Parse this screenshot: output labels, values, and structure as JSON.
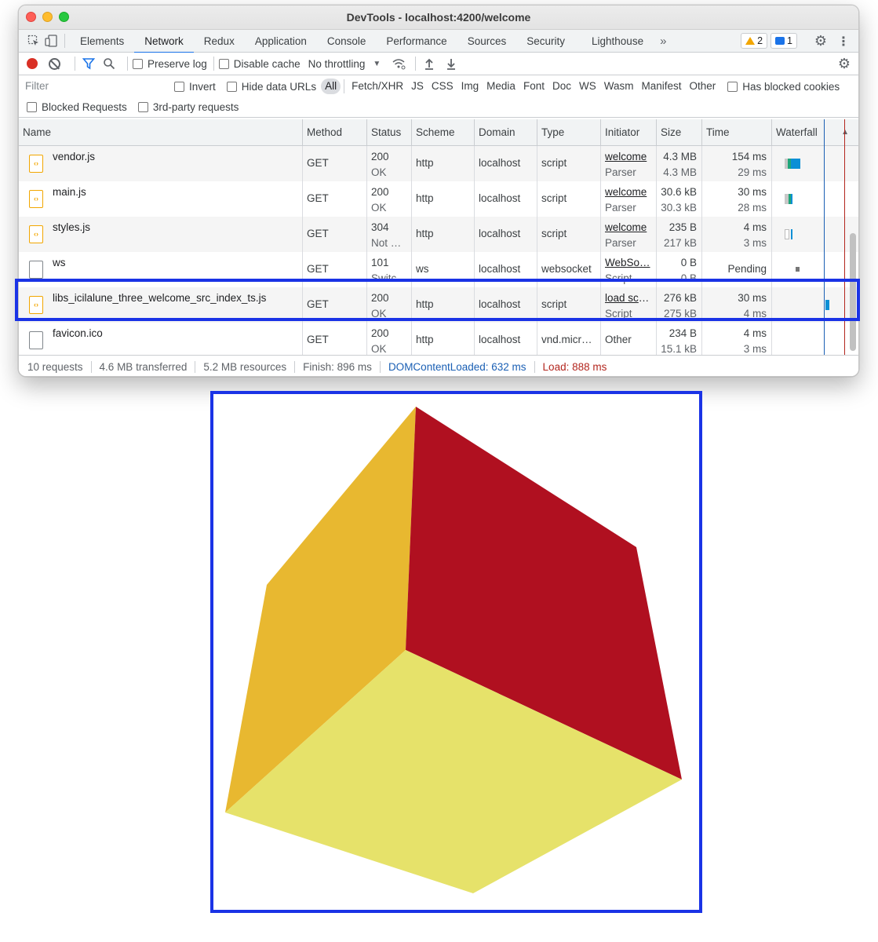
{
  "window": {
    "title": "DevTools - localhost:4200/welcome"
  },
  "tabs": [
    {
      "label": "Elements"
    },
    {
      "label": "Network"
    },
    {
      "label": "Redux"
    },
    {
      "label": "Application"
    },
    {
      "label": "Console"
    },
    {
      "label": "Performance"
    },
    {
      "label": "Sources"
    },
    {
      "label": "Security"
    },
    {
      "label": "Lighthouse"
    }
  ],
  "badges": {
    "warnings": "2",
    "messages": "1"
  },
  "toolbar": {
    "preserve_log": "Preserve log",
    "disable_cache": "Disable cache",
    "throttling": "No throttling"
  },
  "filter": {
    "placeholder": "Filter",
    "invert": "Invert",
    "hide_data_urls": "Hide data URLs",
    "types": [
      "All",
      "Fetch/XHR",
      "JS",
      "CSS",
      "Img",
      "Media",
      "Font",
      "Doc",
      "WS",
      "Wasm",
      "Manifest",
      "Other"
    ],
    "has_blocked_cookies": "Has blocked cookies",
    "blocked_requests": "Blocked Requests",
    "third_party": "3rd-party requests"
  },
  "columns": [
    "Name",
    "Method",
    "Status",
    "Scheme",
    "Domain",
    "Type",
    "Initiator",
    "Size",
    "Time",
    "Waterfall"
  ],
  "rows": [
    {
      "name": "vendor.js",
      "method": "GET",
      "status": "200",
      "status_text": "OK",
      "scheme": "http",
      "domain": "localhost",
      "type": "script",
      "initiator": "welcome",
      "initiator_sub": "Parser",
      "size": "4.3 MB",
      "size_sub": "4.3 MB",
      "time": "154 ms",
      "time_sub": "29 ms",
      "icon": "script-file-icon"
    },
    {
      "name": "main.js",
      "method": "GET",
      "status": "200",
      "status_text": "OK",
      "scheme": "http",
      "domain": "localhost",
      "type": "script",
      "initiator": "welcome",
      "initiator_sub": "Parser",
      "size": "30.6 kB",
      "size_sub": "30.3 kB",
      "time": "30 ms",
      "time_sub": "28 ms",
      "icon": "script-file-icon"
    },
    {
      "name": "styles.js",
      "method": "GET",
      "status": "304",
      "status_text": "Not …",
      "scheme": "http",
      "domain": "localhost",
      "type": "script",
      "initiator": "welcome",
      "initiator_sub": "Parser",
      "size": "235 B",
      "size_sub": "217 kB",
      "time": "4 ms",
      "time_sub": "3 ms",
      "icon": "script-file-icon"
    },
    {
      "name": "ws",
      "method": "GET",
      "status": "101",
      "status_text": "Switc…",
      "scheme": "ws",
      "domain": "localhost",
      "type": "websocket",
      "initiator": "WebSo…",
      "initiator_sub": "Script",
      "size": "0 B",
      "size_sub": "0 B",
      "time": "Pending",
      "time_sub": "",
      "icon": "document-icon"
    },
    {
      "name": "libs_icilalune_three_welcome_src_index_ts.js",
      "method": "GET",
      "status": "200",
      "status_text": "OK",
      "scheme": "http",
      "domain": "localhost",
      "type": "script",
      "initiator": "load scr…",
      "initiator_sub": "Script",
      "size": "276 kB",
      "size_sub": "275 kB",
      "time": "30 ms",
      "time_sub": "4 ms",
      "icon": "script-file-icon"
    },
    {
      "name": "favicon.ico",
      "method": "GET",
      "status": "200",
      "status_text": "OK",
      "scheme": "http",
      "domain": "localhost",
      "type": "vnd.micr…",
      "initiator": "Other",
      "initiator_sub": "",
      "size": "234 B",
      "size_sub": "15.1 kB",
      "time": "4 ms",
      "time_sub": "3 ms",
      "icon": "document-icon"
    }
  ],
  "status": {
    "requests": "10 requests",
    "transferred": "4.6 MB transferred",
    "resources": "5.2 MB resources",
    "finish": "Finish: 896 ms",
    "dom_loaded": "DOMContentLoaded: 632 ms",
    "load": "Load: 888 ms"
  },
  "colors": {
    "accent": "#1a73e8",
    "highlight_border": "#1a33e6",
    "dom_loaded": "#1a5fb4",
    "load": "#b3261e",
    "cube_top": "#b01020",
    "cube_left": "#e8b830",
    "cube_front": "#e6e26a"
  }
}
